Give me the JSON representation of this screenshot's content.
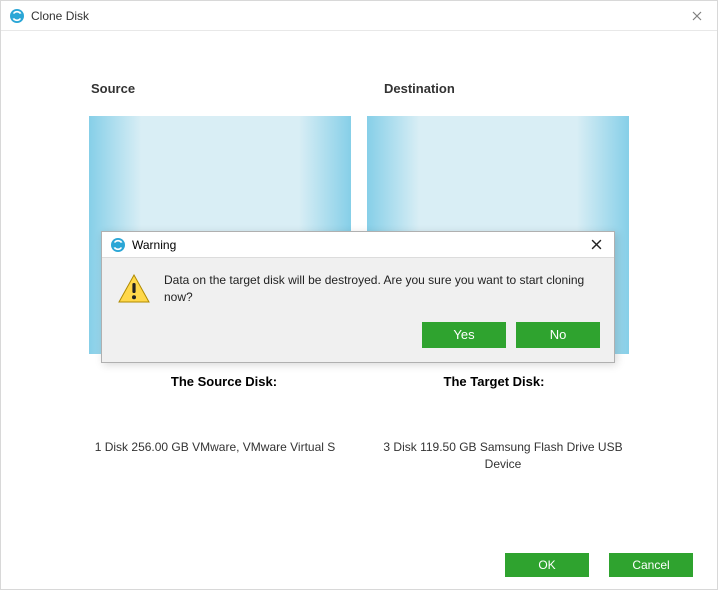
{
  "window": {
    "title": "Clone Disk"
  },
  "headers": {
    "source": "Source",
    "destination": "Destination"
  },
  "labels": {
    "source": "The Source Disk:",
    "target": "The Target Disk:"
  },
  "descriptions": {
    "source": "1 Disk 256.00 GB VMware,  VMware Virtual S",
    "target": "3 Disk 119.50 GB Samsung  Flash Drive USB Device"
  },
  "footer": {
    "ok": "OK",
    "cancel": "Cancel"
  },
  "dialog": {
    "title": "Warning",
    "message": "Data on the target disk will be destroyed. Are you sure you want to start cloning now?",
    "yes": "Yes",
    "no": "No"
  },
  "colors": {
    "primary_button": "#2fa32f"
  }
}
